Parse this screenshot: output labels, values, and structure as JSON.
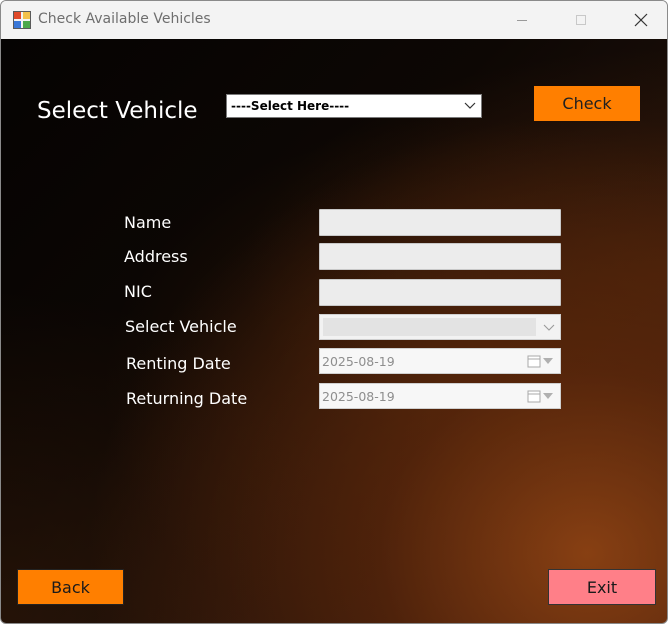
{
  "window": {
    "title": "Check Available Vehicles",
    "icon": "app-icon",
    "controls": [
      "minimize-icon",
      "maximize-icon",
      "close-icon"
    ]
  },
  "header": {
    "heading": "Select Vehicle",
    "vehicle_select": {
      "value": "----Select Here----",
      "icon": "chevron-down-icon"
    },
    "check_label": "Check"
  },
  "form": {
    "name_label": "Name",
    "address_label": "Address",
    "nic_label": "NIC",
    "vehicle_label": "Select Vehicle",
    "renting_label": "Renting Date",
    "returning_label": "Returning Date",
    "name_value": "",
    "address_value": "",
    "nic_value": "",
    "renting_date": "2025-08-19",
    "returning_date": "2025-08-19"
  },
  "footer": {
    "back_label": "Back",
    "exit_label": "Exit"
  },
  "colors": {
    "accent_orange": "#ff7f00",
    "exit_pink": "#ff7f88",
    "background_dark": "#0d0704"
  }
}
